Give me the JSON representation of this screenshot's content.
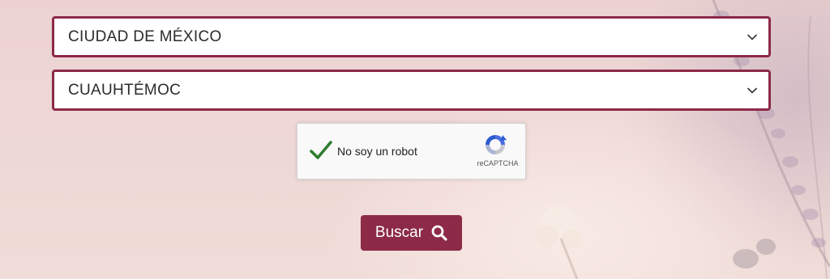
{
  "state_select": {
    "value": "CIUDAD DE MÉXICO",
    "icon": "chevron-down-icon"
  },
  "municipality_select": {
    "value": "CUAUHTÉMOC",
    "icon": "chevron-down-icon"
  },
  "recaptcha": {
    "label": "No soy un robot",
    "brand": "reCAPTCHA",
    "checked": true
  },
  "search_button": {
    "label": "Buscar",
    "icon": "search-icon"
  },
  "colors": {
    "accent": "#8c2a48",
    "check": "#2e7d32"
  }
}
